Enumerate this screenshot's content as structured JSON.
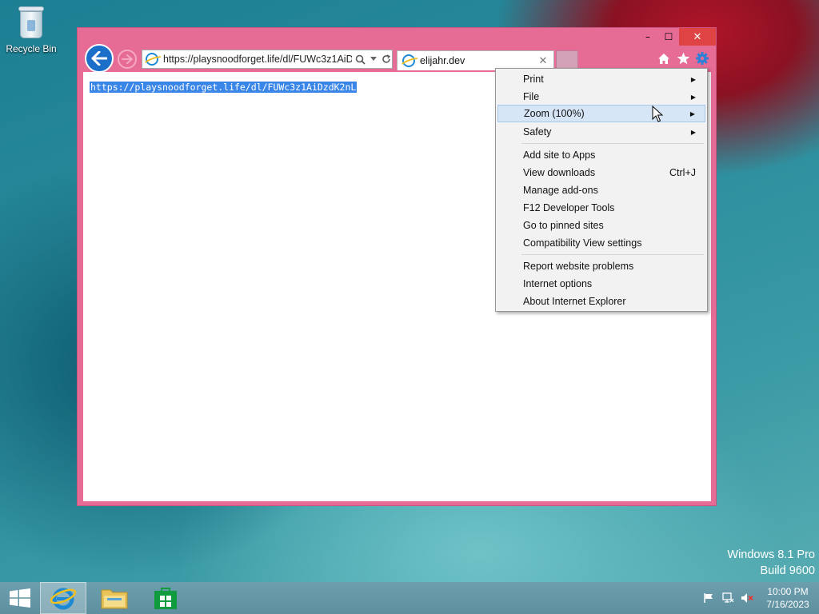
{
  "desktop": {
    "recycle_bin_label": "Recycle Bin",
    "watermark_line1": "Windows 8.1 Pro",
    "watermark_line2": "Build 9600"
  },
  "window": {
    "controls": {
      "minimize": "–",
      "maximize": "☐",
      "close": "✕"
    },
    "address_url": "https://playsnoodforget.life/dl/FUWc3z1AiD:",
    "tab_title": "elijahr.dev",
    "tab_close": "✕",
    "content_selected_text": "https://playsnoodforget.life/dl/FUWc3z1AiDzdK2nL"
  },
  "menu": {
    "items": [
      {
        "label": "Print",
        "submenu": true
      },
      {
        "label": "File",
        "submenu": true
      },
      {
        "label": "Zoom (100%)",
        "submenu": true,
        "highlighted": true
      },
      {
        "label": "Safety",
        "submenu": true
      },
      {
        "label": "Add site to Apps"
      },
      {
        "label": "View downloads",
        "shortcut": "Ctrl+J"
      },
      {
        "label": "Manage add-ons"
      },
      {
        "label": "F12 Developer Tools"
      },
      {
        "label": "Go to pinned sites"
      },
      {
        "label": "Compatibility View settings"
      },
      {
        "label": "Report website problems"
      },
      {
        "label": "Internet options"
      },
      {
        "label": "About Internet Explorer"
      }
    ],
    "submenu_arrow": "▶"
  },
  "taskbar": {
    "apps": [
      "internet-explorer",
      "file-explorer",
      "store"
    ],
    "clock_time": "10:00 PM",
    "clock_date": "7/16/2023"
  },
  "colors": {
    "window_frame": "#e66c96",
    "selection": "#3a86e8",
    "menu_highlight": "#d6e6f7"
  }
}
